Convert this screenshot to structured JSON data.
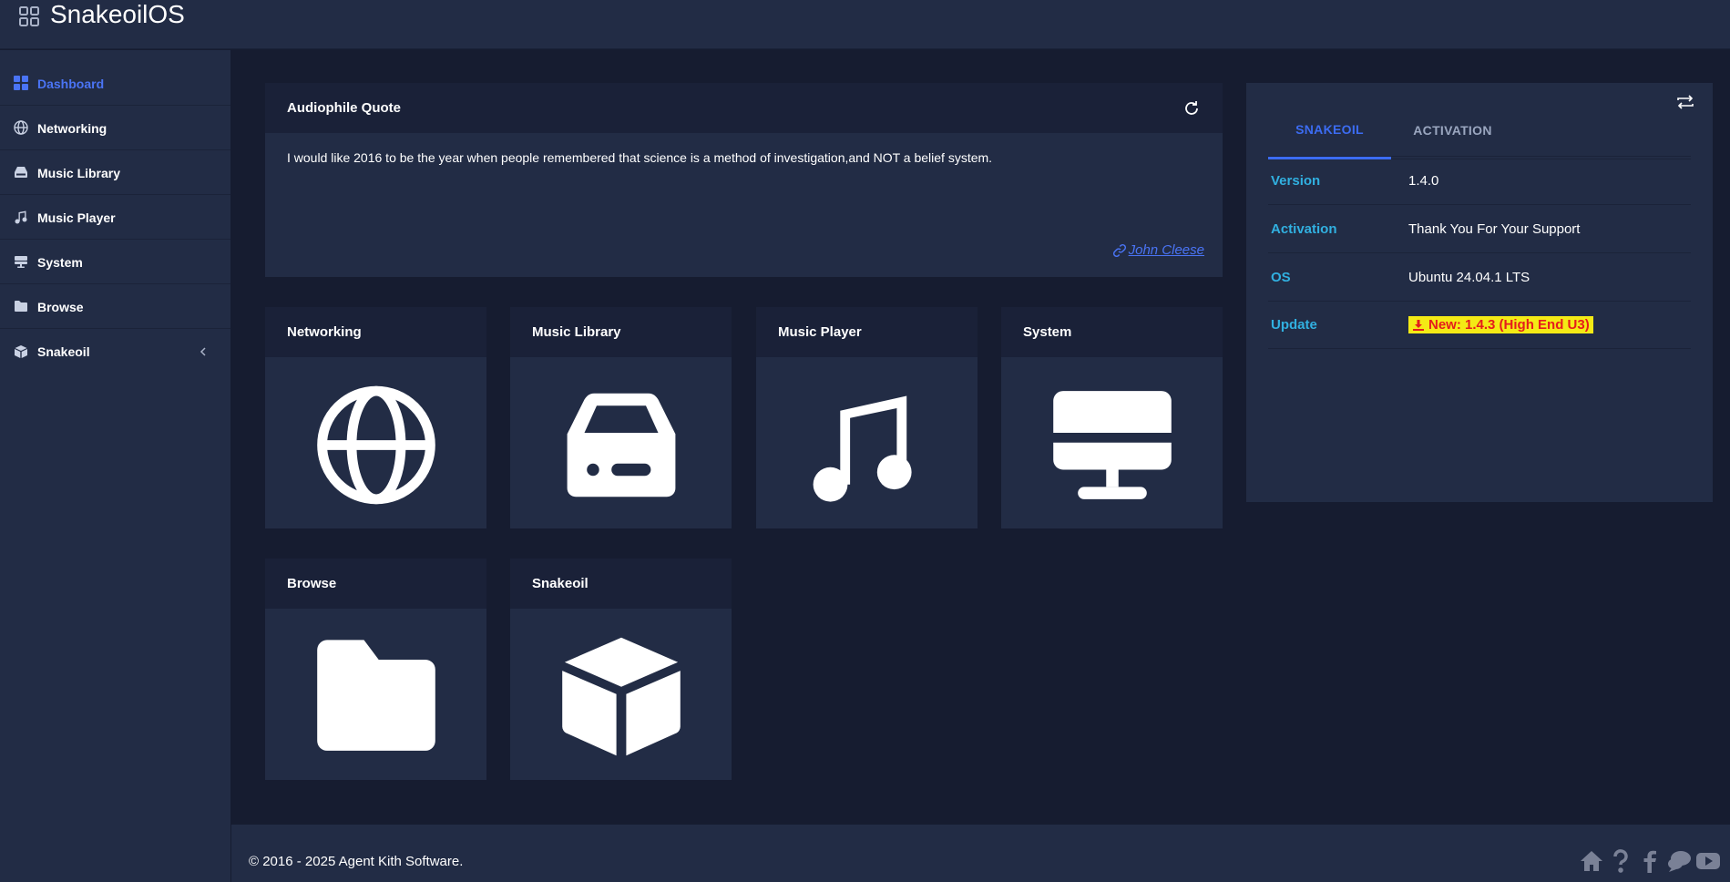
{
  "header": {
    "title": "SnakeoilOS"
  },
  "sidebar": {
    "items": [
      {
        "label": "Dashboard",
        "icon": "dashboard-icon"
      },
      {
        "label": "Networking",
        "icon": "globe-icon"
      },
      {
        "label": "Music Library",
        "icon": "drive-icon"
      },
      {
        "label": "Music Player",
        "icon": "music-note-icon"
      },
      {
        "label": "System",
        "icon": "monitor-icon"
      },
      {
        "label": "Browse",
        "icon": "folder-icon"
      },
      {
        "label": "Snakeoil",
        "icon": "cube-icon"
      }
    ]
  },
  "quote": {
    "title": "Audiophile Quote",
    "text": "I would like 2016 to be the year when people remembered that science is a method of investigation,and NOT a belief system.",
    "author": "John Cleese"
  },
  "tiles": [
    {
      "title": "Networking",
      "icon": "globe-icon"
    },
    {
      "title": "Music Library",
      "icon": "drive-icon"
    },
    {
      "title": "Music Player",
      "icon": "music-note-icon"
    },
    {
      "title": "System",
      "icon": "monitor-icon"
    },
    {
      "title": "Browse",
      "icon": "folder-icon"
    },
    {
      "title": "Snakeoil",
      "icon": "cube-icon"
    }
  ],
  "info": {
    "tabs": [
      {
        "label": "SNAKEOIL"
      },
      {
        "label": "ACTIVATION"
      }
    ],
    "rows": [
      {
        "key": "Version",
        "value": "1.4.0"
      },
      {
        "key": "Activation",
        "value": "Thank You For Your Support"
      },
      {
        "key": "OS",
        "value": "Ubuntu 24.04.1 LTS"
      },
      {
        "key": "Update",
        "value": "New: 1.4.3 (High End U3)"
      }
    ]
  },
  "footer": {
    "copyright": "© 2016 - 2025 Agent Kith Software.",
    "icons": [
      "home-icon",
      "help-icon",
      "facebook-icon",
      "forum-icon",
      "youtube-icon"
    ]
  },
  "colors": {
    "accent": "#3c6cf2",
    "key_text": "#31b0e0",
    "update_bg": "#f4ea15",
    "update_text": "#e51c1c",
    "panel": "#222c45",
    "background": "#161c30"
  }
}
